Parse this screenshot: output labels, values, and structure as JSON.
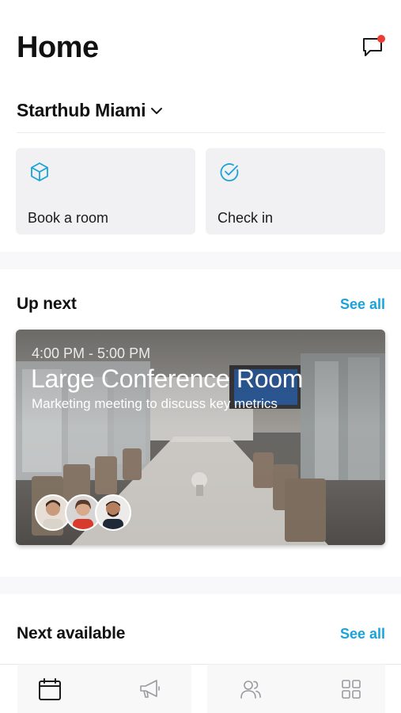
{
  "header": {
    "title": "Home",
    "notification": true
  },
  "location": {
    "name": "Starthub Miami"
  },
  "actions": [
    {
      "label": "Book a room",
      "icon": "cube-icon"
    },
    {
      "label": "Check in",
      "icon": "check-circle-icon"
    }
  ],
  "up_next": {
    "title": "Up next",
    "see_all": "See all",
    "event": {
      "time": "4:00 PM - 5:00 PM",
      "room": "Large Conference Room",
      "description": "Marketing meeting to discuss key metrics",
      "attendee_count": 3
    }
  },
  "next_available": {
    "title": "Next available",
    "see_all": "See all"
  },
  "tabs": [
    {
      "name": "calendar-icon",
      "active": true
    },
    {
      "name": "megaphone-icon",
      "active": false
    },
    {
      "name": "people-icon",
      "active": false
    },
    {
      "name": "grid-icon",
      "active": false
    }
  ],
  "colors": {
    "accent": "#1aa3d9",
    "badge": "#ee3b36",
    "card_bg": "#f1f1f4"
  }
}
